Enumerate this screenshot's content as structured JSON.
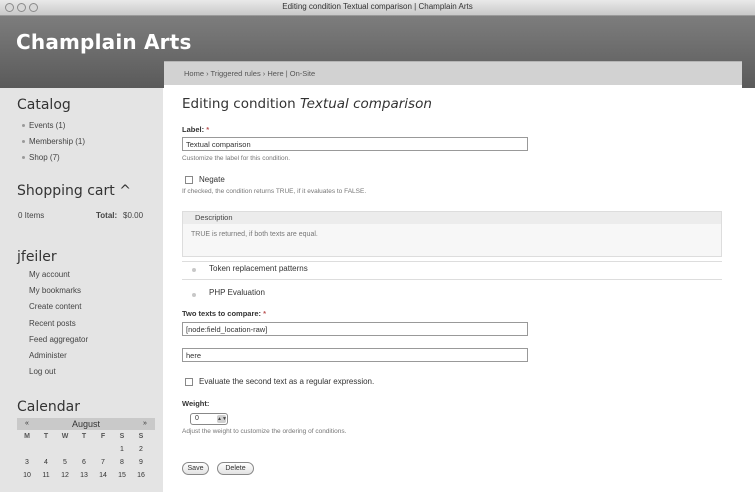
{
  "window": {
    "title": "Editing condition Textual comparison | Champlain Arts"
  },
  "site": {
    "name": "Champlain Arts"
  },
  "breadcrumb": "Home › Triggered rules › Here | On-Site",
  "sidebar": {
    "catalog": {
      "title": "Catalog",
      "items": [
        "Events (1)",
        "Membership (1)",
        "Shop (7)"
      ]
    },
    "cart": {
      "title": "Shopping cart",
      "toggle": "^",
      "items_text": "0 Items",
      "total_label": "Total:",
      "total_value": "$0.00"
    },
    "user": {
      "title": "jfeiler",
      "items": [
        "My account",
        "My bookmarks",
        "Create content",
        "Recent posts",
        "Feed aggregator",
        "Administer",
        "Log out"
      ]
    },
    "calendar": {
      "title": "Calendar",
      "month": "August",
      "prev": "«",
      "next": "»",
      "weekdays": [
        "M",
        "T",
        "W",
        "T",
        "F",
        "S",
        "S"
      ],
      "week1": [
        "",
        "",
        "",
        "",
        "",
        "1",
        "2"
      ],
      "week2": [
        "3",
        "4",
        "5",
        "6",
        "7",
        "8",
        "9"
      ],
      "week3": [
        "10",
        "11",
        "12",
        "13",
        "14",
        "15",
        "16"
      ]
    }
  },
  "main": {
    "title_prefix": "Editing condition",
    "title_name": "Textual comparison",
    "label_field": {
      "label": "Label:",
      "required": "*",
      "value": "Textual comparison",
      "description": "Customize the label for this condition."
    },
    "negate": {
      "label": "Negate",
      "description": "If checked, the condition returns TRUE, if it evaluates to FALSE."
    },
    "description_fieldset": {
      "legend": "Description",
      "text": "TRUE is returned, if both texts are equal."
    },
    "token_patterns": "Token replacement patterns",
    "php_evaluation": "PHP Evaluation",
    "compare": {
      "label": "Two texts to compare:",
      "required": "*",
      "text1": "[node:field_location-raw]",
      "text2": "here"
    },
    "regex_label": "Evaluate the second text as a regular expression.",
    "weight": {
      "label": "Weight:",
      "value": "0",
      "arrow": "▲▼",
      "description": "Adjust the weight to customize the ordering of conditions."
    },
    "buttons": {
      "save": "Save",
      "delete": "Delete"
    }
  }
}
